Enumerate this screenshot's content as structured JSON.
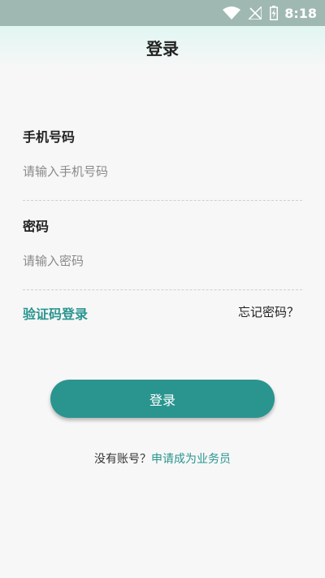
{
  "status_bar": {
    "time": "8:18",
    "icons": [
      "wifi-icon",
      "no-signal-icon",
      "battery-charging-icon"
    ]
  },
  "header": {
    "title": "登录"
  },
  "form": {
    "phone": {
      "label": "手机号码",
      "placeholder": "请输入手机号码",
      "value": ""
    },
    "password": {
      "label": "密码",
      "placeholder": "请输入密码",
      "value": ""
    },
    "sms_login_link": "验证码登录",
    "forgot_password_link": "忘记密码？",
    "submit_label": "登录"
  },
  "register": {
    "prompt": "没有账号？",
    "link": "申请成为业务员"
  },
  "colors": {
    "accent": "#2a958f",
    "status_bar": "#9fb8b2",
    "header_tint": "#e1f6f2",
    "background": "#f7f7f7"
  }
}
